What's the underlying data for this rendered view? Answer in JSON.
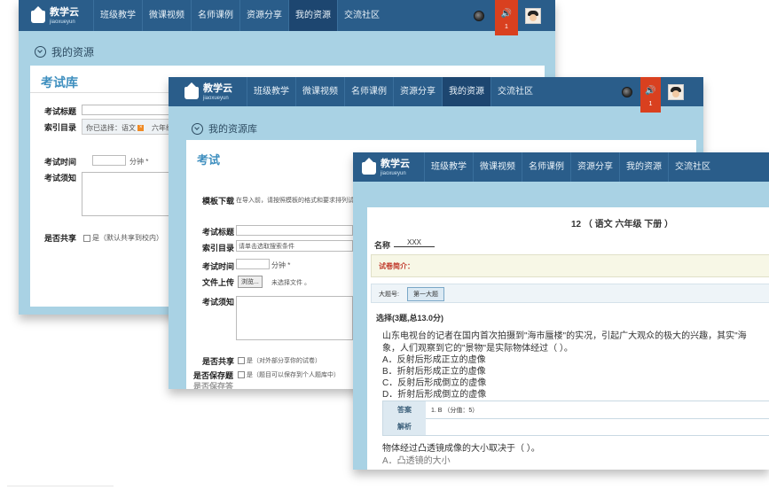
{
  "nav": {
    "logo_title": "教学云",
    "logo_sub": "jiaoxueyun",
    "menu": [
      "班级教学",
      "微课视频",
      "名师课例",
      "资源分享",
      "我的资源",
      "交流社区"
    ],
    "sound_count": "1"
  },
  "win1": {
    "breadcrumb": "我的资源",
    "title": "考试库",
    "fields": {
      "exam_title": "考试标题",
      "index": "索引目录",
      "index_selected": "你已选择：",
      "tag1": "语文",
      "tag2": "六年级",
      "exam_time": "考试时间",
      "minutes": "分钟 *",
      "exam_notes": "考试须知",
      "share": "是否共享",
      "share_option": "是（默认共享到校内）"
    }
  },
  "win2": {
    "breadcrumb": "我的资源库",
    "title": "考试",
    "fields": {
      "template": "模板下载",
      "template_hint": "在导入前，请按照模板的格式和要求排列试",
      "exam_title": "考试标题",
      "index": "索引目录",
      "index_placeholder": "请单击选取搜索条件",
      "exam_time": "考试时间",
      "minutes": "分钟 *",
      "upload": "文件上传",
      "browse": "浏览...",
      "no_file": "未选择文件 。",
      "exam_notes": "考试须知",
      "share": "是否共享",
      "share_option": "是（对外部分享你的试卷）",
      "save_question": "是否保存题",
      "save_option": "是（题目可以保存到个人题库中）",
      "extra": "是否保存答"
    }
  },
  "win3": {
    "paper_title": "12 （ 语文 六年级 下册 ）",
    "name_label": "名称",
    "name_value": "XXX",
    "intro": "试卷简介：",
    "section_label": "大题号:",
    "section_btn": "第一大题",
    "q_header": "选择(3题,总13.0分)",
    "question1": "山东电视台的记者在国内首次拍摄到\"海市蜃楼\"的实况，引起广大观众的极大的兴趣，其实\"海",
    "question1b": "象，人们观察到它的\"景物\"是实际物体经过（   ）。",
    "options": [
      "A．反射后形成正立的虚像",
      "B．折射后形成正立的虚像",
      "C．反射后形成倒立的虚像",
      "D．折射后形成倒立的虚像"
    ],
    "answer_label": "答案",
    "answer_value": "1. B （分值：5）",
    "analysis_label": "解析",
    "question2": "物体经过凸透镜成像的大小取决于（   ）。",
    "question2_option": "A．凸透镜的大小"
  },
  "colors": {
    "nav": "#2a5d8a",
    "accent": "#d9401f",
    "panel_bg": "#a9d2e4"
  }
}
